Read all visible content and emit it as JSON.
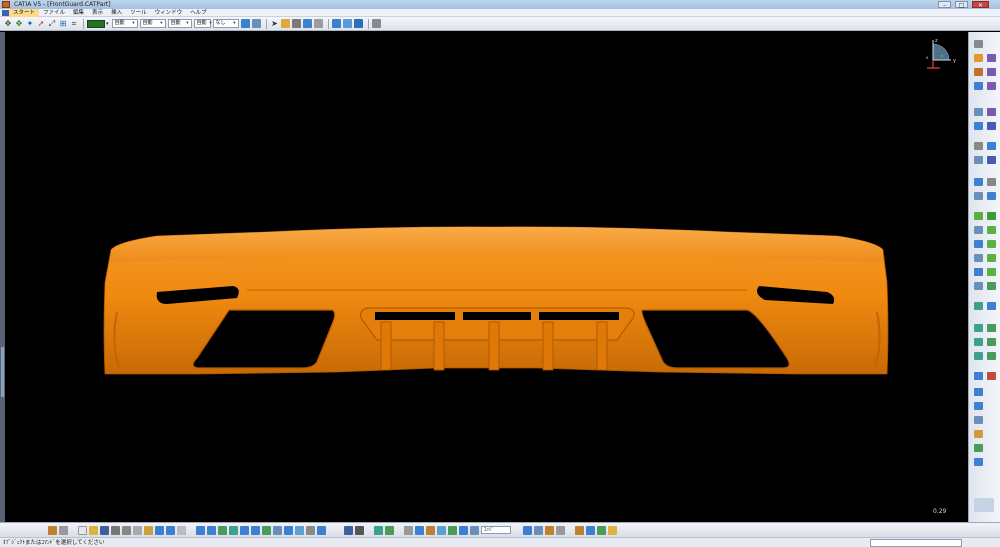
{
  "window": {
    "title": "CATIA V5 - [FrontGuard.CATPart]",
    "minimize": "–",
    "maximize": "□",
    "close": "✕"
  },
  "menu": {
    "items": [
      "スタート",
      "ファイル",
      "編集",
      "表示",
      "挿入",
      "ツール",
      "ウィンドウ",
      "ヘルプ"
    ]
  },
  "toolbar": {
    "color_value": "#1a7a1a",
    "transparency": "自動",
    "line_weight": "自動",
    "line_type": "自動",
    "point_symbol": "自動",
    "layer": "なし"
  },
  "viewport": {
    "zoom_label": "0.29",
    "part_color": "#f08a10",
    "background": "#000000",
    "axes": {
      "x": "x",
      "y": "y",
      "z": "z"
    }
  },
  "status": {
    "prompt": "ｵﾌﾞｼﾞｪｸﾄまたはｺﾏﾝﾄﾞを選択してください"
  },
  "bottom_bar": {
    "view_field": "ｴｯｼﾞ"
  }
}
